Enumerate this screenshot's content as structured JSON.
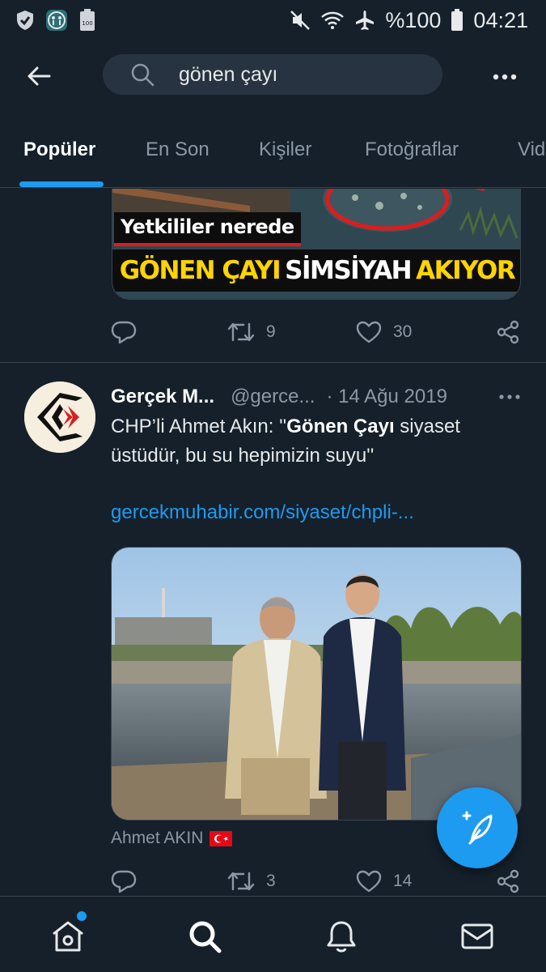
{
  "status_bar": {
    "battery_percent": "%100",
    "time": "04:21",
    "left_icons": [
      "shield-icon",
      "accessibility-app-icon",
      "battery-saver-icon"
    ],
    "right_icons": [
      "mute-icon",
      "wifi-icon",
      "airplane-mode-icon",
      "battery-icon"
    ]
  },
  "search": {
    "query": "gönen çayı"
  },
  "tabs": [
    {
      "label": "Popüler",
      "active": true
    },
    {
      "label": "En Son",
      "active": false
    },
    {
      "label": "Kişiler",
      "active": false
    },
    {
      "label": "Fotoğraflar",
      "active": false
    },
    {
      "label": "Vid",
      "active": false
    }
  ],
  "tweet1": {
    "media_caption_top": "Yetkililer nerede",
    "media_caption_bottom_1": "GÖNEN ÇAYI",
    "media_caption_bottom_2": "SİMSİYAH",
    "media_caption_bottom_3": "AKIYOR",
    "retweets": "9",
    "likes": "30"
  },
  "tweet2": {
    "name": "Gerçek M...",
    "handle": "@gerce...",
    "date": "· 14 Ağu 2019",
    "text_before": "CHP’li Ahmet Akın: ''",
    "text_bold": "Gönen Çayı",
    "text_after": " siyaset üstüdür, bu su hepimizin suyu''",
    "link": "gercekmuhabir.com/siyaset/chpli-...",
    "media_caption": "Ahmet AKIN",
    "retweets": "3",
    "likes": "14"
  },
  "colors": {
    "background": "#15202b",
    "accent": "#1d9bf0",
    "secondary_text": "#8b98a5",
    "divider": "#38444d"
  },
  "bottom_nav": {
    "items": [
      "home-icon",
      "search-icon",
      "notifications-icon",
      "messages-icon"
    ],
    "home_has_badge": true
  }
}
